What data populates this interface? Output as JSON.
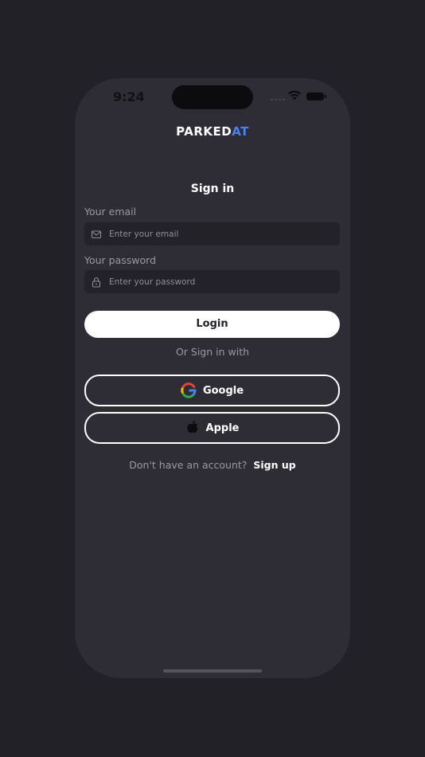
{
  "status_bar": {
    "time": "9:24"
  },
  "logo": {
    "part1": "PARKED",
    "part2": "AT",
    "accent_color": "#4d7ff5"
  },
  "title": "Sign in",
  "email": {
    "label": "Your email",
    "placeholder": "Enter your email",
    "value": "",
    "icon": "mail-icon"
  },
  "password": {
    "label": "Your password",
    "placeholder": "Enter your password",
    "value": "",
    "icon": "lock-icon"
  },
  "login_button": "Login",
  "divider_text": "Or Sign in with",
  "social": {
    "google": {
      "label": "Google",
      "icon": "google-icon"
    },
    "apple": {
      "label": "Apple",
      "icon": "apple-icon"
    }
  },
  "signup": {
    "prompt": "Don't have an account?",
    "link": "Sign up"
  },
  "colors": {
    "background": "#222128",
    "screen": "#2e2d35",
    "field": "#232228"
  }
}
